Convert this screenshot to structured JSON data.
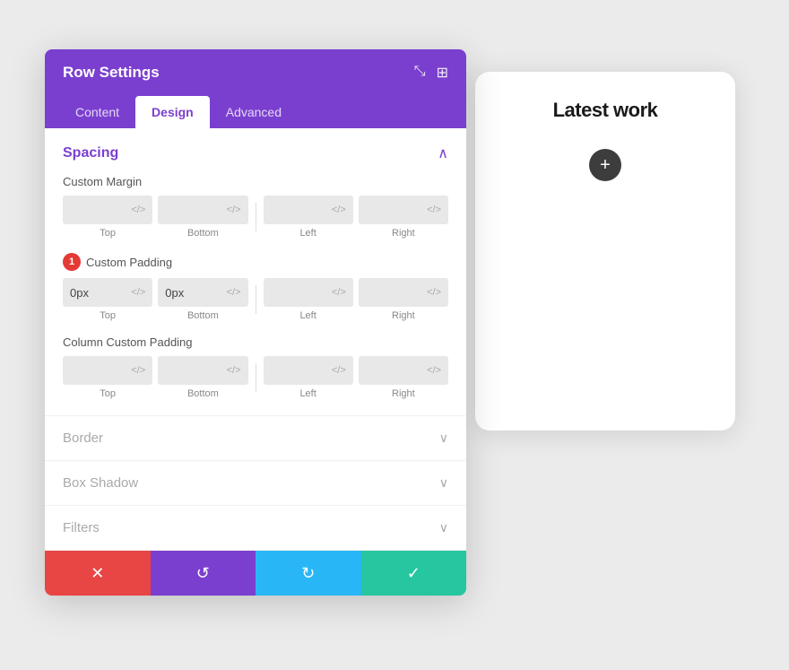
{
  "panel": {
    "title": "Row Settings",
    "tabs": [
      {
        "label": "Content",
        "active": false
      },
      {
        "label": "Design",
        "active": true
      },
      {
        "label": "Advanced",
        "active": false
      }
    ],
    "header_icon1": "⤡",
    "header_icon2": "⊞"
  },
  "spacing": {
    "section_title": "Spacing",
    "custom_margin": {
      "label": "Custom Margin",
      "fields": [
        {
          "value": "",
          "sublabel": "Top"
        },
        {
          "value": "",
          "sublabel": "Bottom"
        },
        {
          "value": "",
          "sublabel": "Left"
        },
        {
          "value": "",
          "sublabel": "Right"
        }
      ]
    },
    "custom_padding": {
      "label": "Custom Padding",
      "badge": "1",
      "fields": [
        {
          "value": "0px",
          "sublabel": "Top"
        },
        {
          "value": "0px",
          "sublabel": "Bottom"
        },
        {
          "value": "",
          "sublabel": "Left"
        },
        {
          "value": "",
          "sublabel": "Right"
        }
      ]
    },
    "column_custom_padding": {
      "label": "Column Custom Padding",
      "fields": [
        {
          "value": "",
          "sublabel": "Top"
        },
        {
          "value": "",
          "sublabel": "Bottom"
        },
        {
          "value": "",
          "sublabel": "Left"
        },
        {
          "value": "",
          "sublabel": "Right"
        }
      ]
    }
  },
  "collapsed_sections": [
    {
      "label": "Border"
    },
    {
      "label": "Box Shadow"
    },
    {
      "label": "Filters"
    }
  ],
  "toolbar": {
    "cancel_label": "✕",
    "undo_label": "↺",
    "redo_label": "↻",
    "save_label": "✓"
  },
  "preview": {
    "title": "Latest work",
    "add_icon": "+"
  }
}
